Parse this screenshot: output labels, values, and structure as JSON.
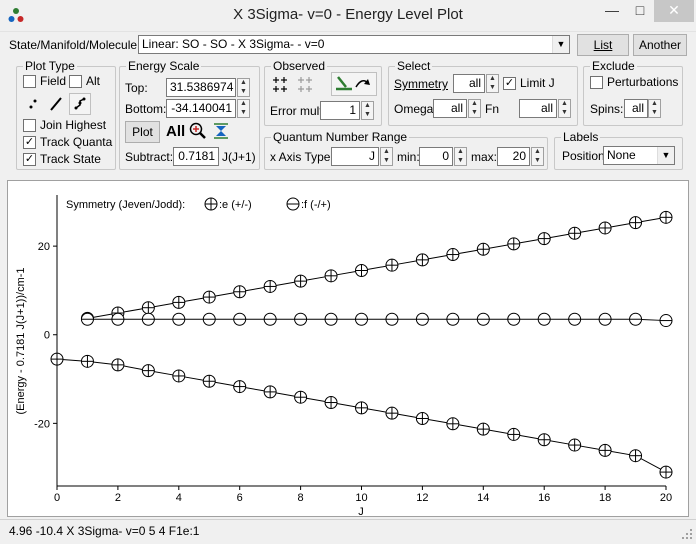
{
  "window": {
    "title": "X 3Sigma- v=0 - Energy Level Plot",
    "minimize": "—",
    "maximize": "□",
    "close": "✕"
  },
  "top": {
    "selector_label": "State/Manifold/Molecule:",
    "selector_value": "Linear: SO - SO - X 3Sigma- - v=0",
    "list_button": "List",
    "another_button": "Another"
  },
  "plot_type": {
    "title": "Plot Type",
    "field_label": "Field",
    "field_checked": false,
    "alt_label": "Alt",
    "alt_checked": false,
    "join_highest_label": "Join Highest",
    "join_highest_checked": false,
    "track_quanta_label": "Track Quanta",
    "track_quanta_checked": true,
    "track_state_label": "Track State",
    "track_state_checked": true
  },
  "energy_scale": {
    "title": "Energy Scale",
    "top_label": "Top:",
    "top_value": "31.5386974",
    "bottom_label": "Bottom:",
    "bottom_value": "-34.140041",
    "plot_button": "Plot",
    "all_button": "All",
    "subtract_label": "Subtract:",
    "subtract_value": "0.7181",
    "subtract_unit": "J(J+1)"
  },
  "observed": {
    "title": "Observed",
    "error_mult_label": "Error mult:",
    "error_mult_value": "1"
  },
  "select": {
    "title": "Select",
    "symmetry_label": "Symmetry",
    "symmetry_value": "all",
    "limit_j_label": "Limit J",
    "limit_j_checked": true,
    "omega_label": "Omega",
    "omega_value": "all",
    "fn_label": "Fn",
    "fn_value": "all"
  },
  "exclude": {
    "title": "Exclude",
    "perturbations_label": "Perturbations",
    "perturbations_checked": false,
    "spins_label": "Spins:",
    "spins_value": "all"
  },
  "qn_range": {
    "title": "Quantum Number Range",
    "xaxis_label": "x Axis Type",
    "xaxis_value": "J",
    "min_label": "min:",
    "min_value": "0",
    "max_label": "max:",
    "max_value": "20"
  },
  "labels": {
    "title": "Labels",
    "position_label": "Position",
    "position_value": "None"
  },
  "chart_data": {
    "type": "scatter",
    "legend_title": "Symmetry (Jeven/Jodd):",
    "legend_e": ":e (+/-)",
    "legend_f": ":f (-/+)",
    "xlabel": "J",
    "ylabel": "(Energy - 0.7181 J(J+1))/cm-1",
    "xlim": [
      0,
      20
    ],
    "ylim": [
      -34.14,
      31.54
    ],
    "xticks": [
      0,
      2,
      4,
      6,
      8,
      10,
      12,
      14,
      16,
      18,
      20
    ],
    "yticks": [
      -20,
      0,
      20
    ],
    "series": [
      {
        "marker": "plus-circle",
        "x": [
          1,
          2,
          3,
          4,
          5,
          6,
          7,
          8,
          9,
          10,
          11,
          12,
          13,
          14,
          15,
          16,
          17,
          18,
          19,
          20
        ],
        "y": [
          3.7,
          4.9,
          6.1,
          7.3,
          8.5,
          9.7,
          10.9,
          12.1,
          13.3,
          14.5,
          15.7,
          16.9,
          18.1,
          19.3,
          20.5,
          21.7,
          22.9,
          24.1,
          25.3,
          26.5
        ]
      },
      {
        "marker": "minus-circle",
        "x": [
          1,
          2,
          3,
          4,
          5,
          6,
          7,
          8,
          9,
          10,
          11,
          12,
          13,
          14,
          15,
          16,
          17,
          18,
          19,
          20
        ],
        "y": [
          3.5,
          3.5,
          3.5,
          3.5,
          3.5,
          3.5,
          3.5,
          3.5,
          3.5,
          3.5,
          3.5,
          3.5,
          3.5,
          3.5,
          3.5,
          3.5,
          3.5,
          3.5,
          3.5,
          3.2
        ]
      },
      {
        "marker": "plus-circle",
        "x": [
          0,
          1,
          2,
          3,
          4,
          5,
          6,
          7,
          8,
          9,
          10,
          11,
          12,
          13,
          14,
          15,
          16,
          17,
          18,
          19,
          20
        ],
        "y": [
          -5.5,
          -6.0,
          -6.8,
          -8.1,
          -9.3,
          -10.5,
          -11.7,
          -12.9,
          -14.1,
          -15.3,
          -16.5,
          -17.7,
          -18.9,
          -20.1,
          -21.3,
          -22.5,
          -23.7,
          -24.9,
          -26.1,
          -27.3,
          -31.0
        ]
      }
    ]
  },
  "status": {
    "text": "4.96  -10.4 X 3Sigma- v=0  5  4 F1e:1"
  }
}
